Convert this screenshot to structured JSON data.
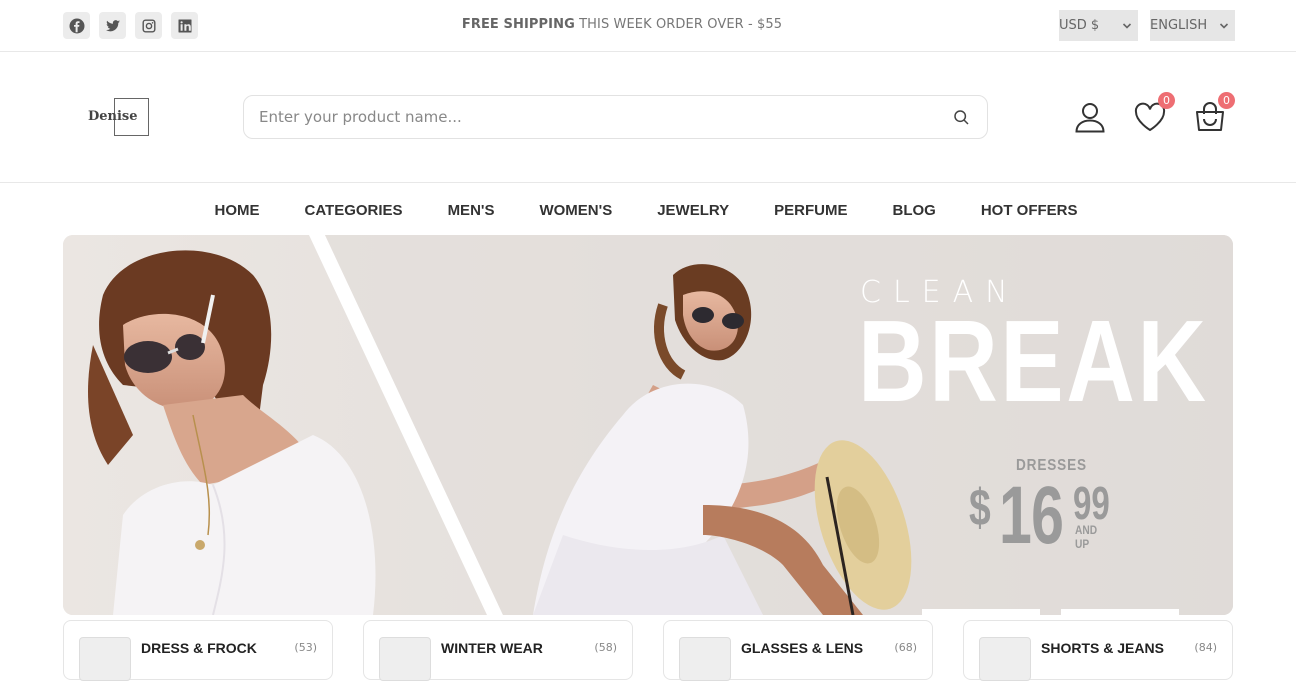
{
  "topbar": {
    "socials": [
      {
        "icon": "facebook-icon"
      },
      {
        "icon": "twitter-icon"
      },
      {
        "icon": "instagram-icon"
      },
      {
        "icon": "linkedin-icon"
      }
    ],
    "shipping_bold": "FREE SHIPPING",
    "shipping_rest": " THIS WEEK ORDER OVER - $55",
    "currency": "USD $",
    "language": "ENGLISH"
  },
  "header": {
    "logo_text": "Denise",
    "search_placeholder": "Enter your product name...",
    "wishlist_count": "0",
    "cart_count": "0"
  },
  "nav": {
    "items": [
      "HOME",
      "CATEGORIES",
      "MEN'S",
      "WOMEN'S",
      "JEWELRY",
      "PERFUME",
      "BLOG",
      "HOT OFFERS"
    ]
  },
  "banner": {
    "line1": "CLEAN",
    "line2": "BREAK",
    "category": "DRESSES",
    "currency": "$",
    "price_int": "16",
    "price_dec": "99",
    "suffix": "AND UP"
  },
  "categories": [
    {
      "name": "DRESS & FROCK",
      "count": "(53)"
    },
    {
      "name": "WINTER WEAR",
      "count": "(58)"
    },
    {
      "name": "GLASSES & LENS",
      "count": "(68)"
    },
    {
      "name": "SHORTS & JEANS",
      "count": "(84)"
    }
  ],
  "colors": {
    "badge": "#ee6e73",
    "banner_bg": "#e6e2df",
    "price": "#9a9a9a"
  }
}
